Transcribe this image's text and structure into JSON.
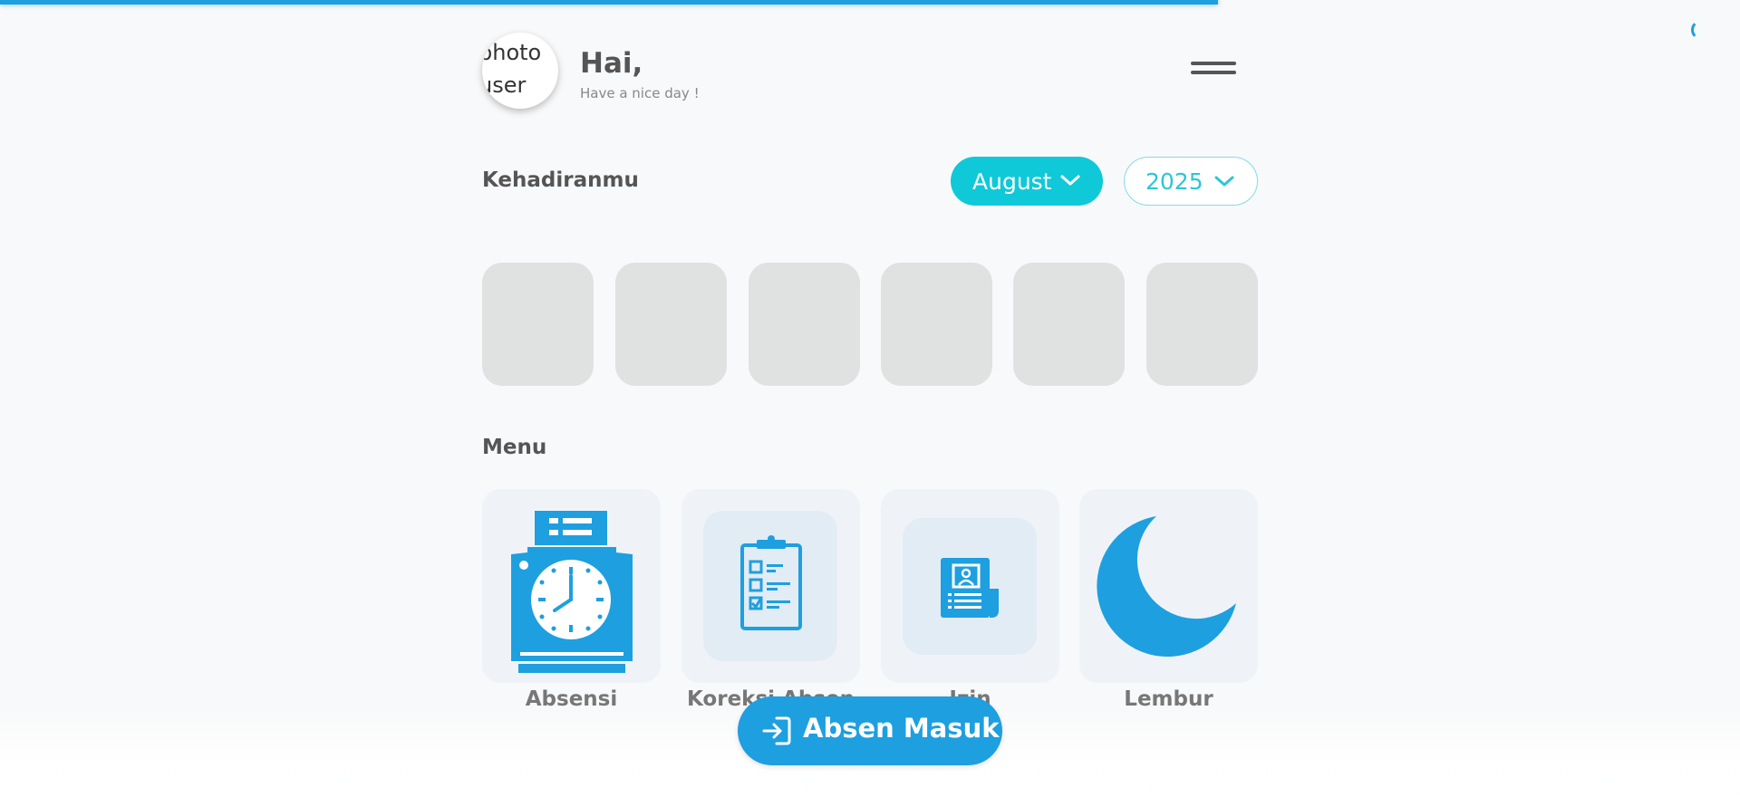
{
  "page": {
    "load_progress_percent": 70
  },
  "header": {
    "avatar_alt": "photo user",
    "greeting": "Hai,",
    "subtitle": "Have a nice day !"
  },
  "attendance": {
    "title": "Kehadiranmu",
    "month": "August",
    "year": "2025",
    "skeleton_count": 6
  },
  "menu": {
    "title": "Menu",
    "items": [
      {
        "label": "Absensi",
        "icon": "time-clock-icon"
      },
      {
        "label": "Koreksi Absen",
        "icon": "checklist-clipboard-icon"
      },
      {
        "label": "Izin",
        "icon": "id-document-icon"
      },
      {
        "label": "Lembur",
        "icon": "moon-icon"
      }
    ]
  },
  "cta": {
    "label": "Absen Masuk",
    "icon": "login-arrow-icon"
  },
  "colors": {
    "accent": "#1e9fe0",
    "cyan": "#0fc9d8",
    "skeleton": "#e0e1e1",
    "card": "#eff3f8"
  }
}
